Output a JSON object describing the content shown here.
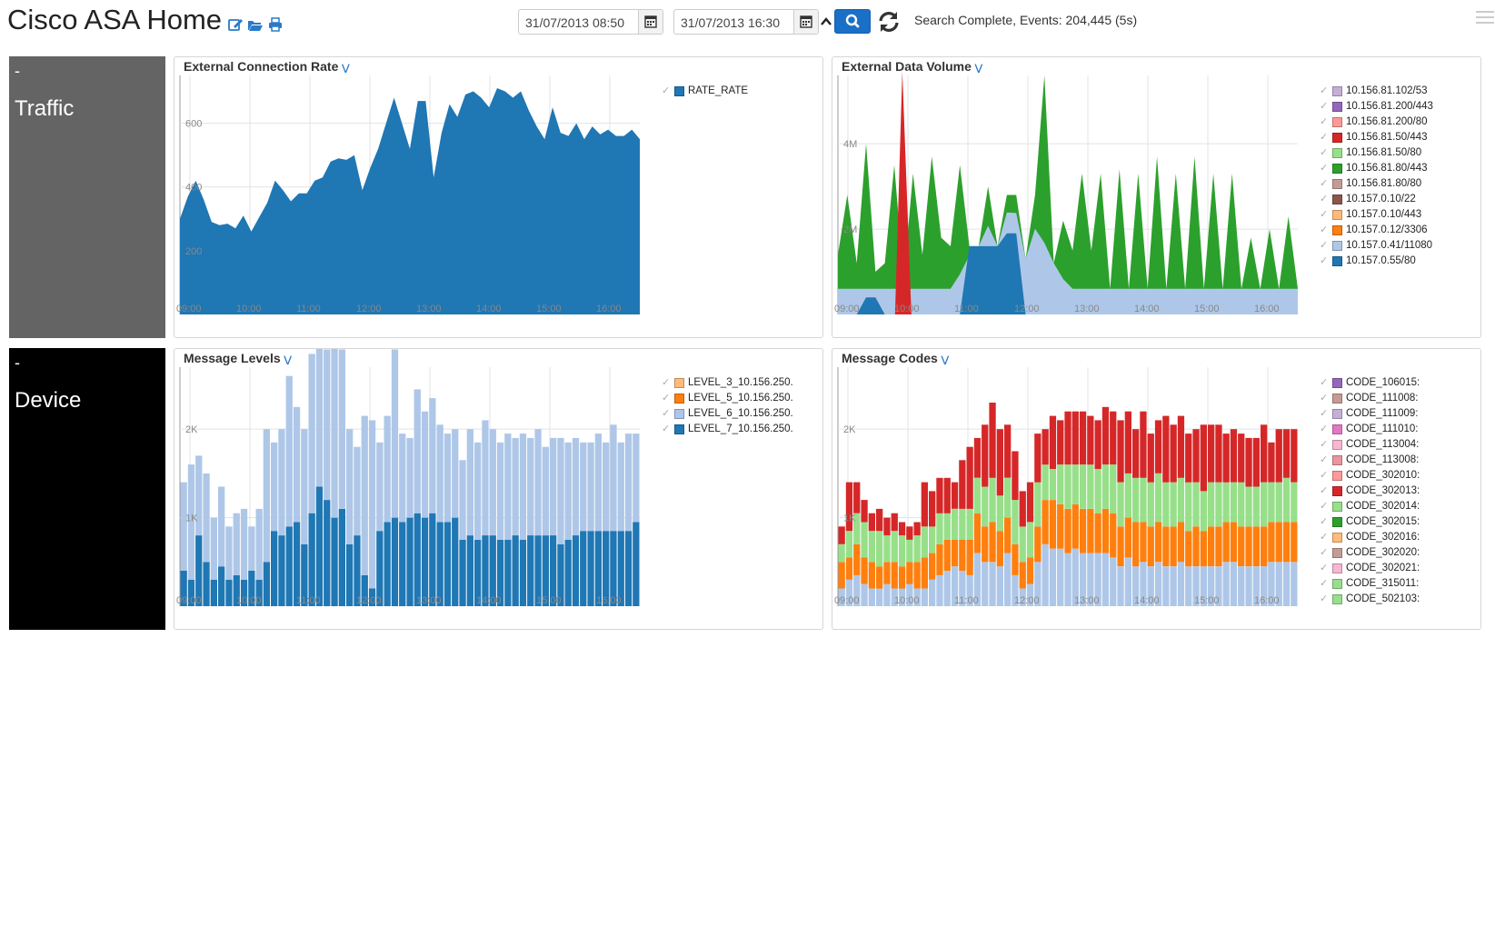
{
  "header": {
    "title": "Cisco ASA Home",
    "start_date": "31/07/2013 08:50",
    "end_date": "31/07/2013 16:30",
    "status": "Search Complete, Events: 204,445 (5s)",
    "icons": [
      "edit-icon",
      "folder-open-icon",
      "print-icon",
      "calendar-icon",
      "chevron-up-icon",
      "search-icon",
      "refresh-icon",
      "menu-icon"
    ]
  },
  "rows": [
    {
      "label": "Traffic",
      "collapse": "-",
      "color": "#646464"
    },
    {
      "label": "Device",
      "collapse": "-",
      "color": "#000000"
    }
  ],
  "panels": {
    "rate": {
      "title": "External Connection Rate"
    },
    "volume": {
      "title": "External Data Volume"
    },
    "levels": {
      "title": "Message Levels"
    },
    "codes": {
      "title": "Message Codes"
    }
  },
  "chart_data": [
    {
      "id": "rate",
      "type": "area",
      "title": "External Connection Rate",
      "x_ticks": [
        "09:00",
        "10:00",
        "11:00",
        "12:00",
        "13:00",
        "14:00",
        "15:00",
        "16:00"
      ],
      "y_ticks": [
        "200",
        "400",
        "600"
      ],
      "ylim": [
        0,
        750
      ],
      "x_range": [
        "08:50",
        "16:30"
      ],
      "grid": true,
      "legend_position": "right",
      "series": [
        {
          "name": "RATE_RATE",
          "color": "#1f77b4",
          "values": [
            300,
            370,
            420,
            360,
            290,
            280,
            285,
            270,
            310,
            260,
            305,
            350,
            420,
            390,
            355,
            380,
            380,
            420,
            430,
            480,
            490,
            485,
            500,
            390,
            460,
            520,
            600,
            680,
            600,
            520,
            670,
            670,
            430,
            570,
            660,
            620,
            690,
            700,
            680,
            650,
            710,
            700,
            680,
            700,
            640,
            590,
            550,
            650,
            570,
            560,
            600,
            550,
            590,
            565,
            580,
            560,
            560,
            580,
            550
          ]
        }
      ]
    },
    {
      "id": "volume",
      "type": "area",
      "title": "External Data Volume",
      "x_ticks": [
        "09:00",
        "10:00",
        "11:00",
        "12:00",
        "13:00",
        "14:00",
        "15:00",
        "16:00"
      ],
      "y_ticks": [
        "2M",
        "4M"
      ],
      "ylim": [
        0,
        5600000
      ],
      "legend_position": "right",
      "series": [
        {
          "name": "10.156.81.102/53",
          "color": "#c5b0d5",
          "values": []
        },
        {
          "name": "10.156.81.200/443",
          "color": "#9467bd",
          "values": []
        },
        {
          "name": "10.156.81.200/80",
          "color": "#ff9896",
          "values": []
        },
        {
          "name": "10.156.81.50/443",
          "color": "#d62728",
          "values": []
        },
        {
          "name": "10.156.81.50/80",
          "color": "#98df8a",
          "values": []
        },
        {
          "name": "10.156.81.80/443",
          "color": "#2ca02c",
          "values": []
        },
        {
          "name": "10.156.81.80/80",
          "color": "#c49c94",
          "values": []
        },
        {
          "name": "10.157.0.10/22",
          "color": "#8c564b",
          "values": []
        },
        {
          "name": "10.157.0.10/443",
          "color": "#ffbb78",
          "values": []
        },
        {
          "name": "10.157.0.12/3306",
          "color": "#ff7f0e",
          "values": []
        },
        {
          "name": "10.157.0.41/11080",
          "color": "#aec7e8",
          "values": []
        },
        {
          "name": "10.157.0.55/80",
          "color": "#1f77b4",
          "values": []
        }
      ],
      "plotted": {
        "green": [
          1400000,
          2800000,
          1200000,
          4000000,
          1000000,
          1200000,
          3500000,
          800000,
          3300000,
          1400000,
          3700000,
          1800000,
          1600000,
          3500000,
          1600000,
          1600000,
          3000000,
          1600000,
          2800000,
          2800000,
          1300000,
          2800000,
          5600000,
          1200000,
          2200000,
          1500000,
          3300000,
          1500000,
          3300000,
          600000,
          3400000,
          600000,
          3300000,
          600000,
          3700000,
          600000,
          3300000,
          600000,
          3700000,
          600000,
          3300000,
          600000,
          3300000,
          600000,
          1800000,
          600000,
          2000000,
          600000,
          2300000,
          600000
        ],
        "red_spike": 5700000
      }
    },
    {
      "id": "levels",
      "type": "bar",
      "title": "Message Levels",
      "x_ticks": [
        "09:00",
        "10:00",
        "11:00",
        "12:00",
        "13:00",
        "14:00",
        "15:00",
        "16:00"
      ],
      "y_ticks": [
        "1K",
        "2K"
      ],
      "ylim": [
        0,
        2700
      ],
      "legend_position": "right",
      "series": [
        {
          "name": "LEVEL_3_10.156.250.",
          "color": "#ffbb78",
          "values": []
        },
        {
          "name": "LEVEL_5_10.156.250.",
          "color": "#ff7f0e",
          "values": []
        },
        {
          "name": "LEVEL_6_10.156.250.",
          "color": "#aec7e8",
          "values": [
            1000,
            1300,
            900,
            1000,
            700,
            900,
            600,
            700,
            800,
            500,
            800,
            1500,
            1000,
            1200,
            1700,
            1300,
            1300,
            1800,
            1600,
            1700,
            2200,
            1800,
            1300,
            1000,
            1800,
            1900,
            1000,
            1200,
            1900,
            1000,
            900,
            1400,
            1200,
            1300,
            1100,
            1000,
            1000,
            900,
            1200,
            1100,
            1300,
            1200,
            1100,
            1200,
            1100,
            1200,
            1100,
            1200,
            1000,
            1100,
            1200,
            1100,
            1100,
            1000,
            1000,
            1100,
            1000,
            1200,
            1000,
            1100,
            1000
          ]
        },
        {
          "name": "LEVEL_7_10.156.250.",
          "color": "#1f77b4",
          "values": [
            400,
            300,
            800,
            500,
            300,
            450,
            300,
            350,
            300,
            400,
            300,
            500,
            850,
            800,
            900,
            950,
            700,
            1050,
            1350,
            1200,
            1000,
            1100,
            700,
            800,
            350,
            200,
            850,
            950,
            1000,
            950,
            1000,
            1050,
            1000,
            1050,
            950,
            950,
            1000,
            750,
            800,
            750,
            800,
            800,
            750,
            750,
            800,
            750,
            800,
            800,
            800,
            800,
            700,
            750,
            800,
            850,
            850,
            850,
            850,
            850,
            850,
            850,
            950
          ]
        }
      ]
    },
    {
      "id": "codes",
      "type": "bar",
      "title": "Message Codes",
      "x_ticks": [
        "09:00",
        "10:00",
        "11:00",
        "12:00",
        "13:00",
        "14:00",
        "15:00",
        "16:00"
      ],
      "y_ticks": [
        "1K",
        "2K"
      ],
      "ylim": [
        0,
        2700
      ],
      "legend_position": "right",
      "series": [
        {
          "name": "CODE_106015:",
          "color": "#9467bd",
          "values": []
        },
        {
          "name": "CODE_111008:",
          "color": "#c49c94",
          "values": []
        },
        {
          "name": "CODE_111009:",
          "color": "#c5b0d5",
          "values": []
        },
        {
          "name": "CODE_111010:",
          "color": "#e377c2",
          "values": []
        },
        {
          "name": "CODE_113004:",
          "color": "#f7b6d2",
          "values": []
        },
        {
          "name": "CODE_113008:",
          "color": "#e7969c",
          "values": []
        },
        {
          "name": "CODE_302010:",
          "color": "#ff9896",
          "values": []
        },
        {
          "name": "CODE_302013:",
          "color": "#d62728",
          "values": []
        },
        {
          "name": "CODE_302014:",
          "color": "#98df8a",
          "values": []
        },
        {
          "name": "CODE_302015:",
          "color": "#2ca02c",
          "values": []
        },
        {
          "name": "CODE_302016:",
          "color": "#ffbb78",
          "values": []
        },
        {
          "name": "CODE_302020:",
          "color": "#c49c94",
          "values": []
        },
        {
          "name": "CODE_302021:",
          "color": "#f7b6d2",
          "values": []
        },
        {
          "name": "CODE_315011:",
          "color": "#98df8a",
          "values": []
        },
        {
          "name": "CODE_502103:",
          "color": "#98df8a",
          "values": []
        }
      ],
      "plotted": {
        "blue": [
          200,
          300,
          350,
          250,
          200,
          200,
          250,
          200,
          200,
          250,
          200,
          200,
          300,
          350,
          400,
          450,
          400,
          350,
          600,
          500,
          500,
          450,
          600,
          350,
          200,
          250,
          500,
          700,
          650,
          650,
          600,
          650,
          600,
          600,
          600,
          600,
          550,
          450,
          550,
          450,
          500,
          450,
          500,
          450,
          450,
          500,
          450,
          450,
          450,
          450,
          450,
          500,
          500,
          450,
          450,
          450,
          450,
          500,
          500,
          500,
          500
        ],
        "orange": [
          300,
          250,
          350,
          300,
          300,
          250,
          250,
          300,
          250,
          250,
          300,
          350,
          300,
          350,
          350,
          300,
          350,
          400,
          450,
          400,
          450,
          400,
          400,
          350,
          300,
          300,
          400,
          500,
          550,
          500,
          500,
          500,
          500,
          500,
          450,
          500,
          500,
          450,
          450,
          500,
          450,
          450,
          450,
          450,
          450,
          450,
          400,
          450,
          400,
          450,
          450,
          450,
          450,
          450,
          450,
          450,
          450,
          450,
          450,
          450,
          450
        ],
        "lgreen": [
          200,
          300,
          350,
          400,
          350,
          400,
          300,
          350,
          350,
          250,
          300,
          350,
          300,
          350,
          300,
          350,
          350,
          350,
          400,
          450,
          500,
          400,
          450,
          500,
          400,
          400,
          500,
          400,
          350,
          450,
          500,
          450,
          500,
          500,
          500,
          500,
          550,
          500,
          500,
          500,
          500,
          500,
          550,
          500,
          500,
          500,
          550,
          500,
          450,
          500,
          500,
          450,
          450,
          500,
          450,
          450,
          500,
          450,
          450,
          500,
          450
        ],
        "red": [
          200,
          550,
          350,
          250,
          200,
          250,
          200,
          200,
          150,
          150,
          150,
          500,
          400,
          400,
          400,
          300,
          550,
          700,
          450,
          700,
          850,
          750,
          600,
          550,
          400,
          450,
          550,
          400,
          600,
          500,
          600,
          600,
          600,
          550,
          550,
          650,
          600,
          700,
          700,
          550,
          750,
          550,
          600,
          750,
          650,
          700,
          550,
          600,
          750,
          650,
          650,
          550,
          600,
          550,
          550,
          550,
          650,
          450,
          600,
          550,
          600
        ]
      }
    }
  ]
}
